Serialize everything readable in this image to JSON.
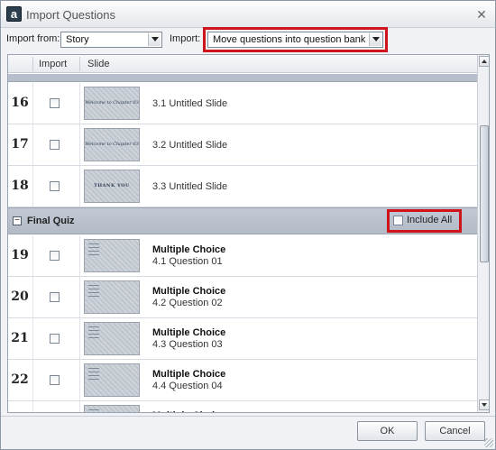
{
  "window": {
    "title": "Import Questions",
    "app_icon_glyph": "a",
    "close_glyph": "✕"
  },
  "toolbar": {
    "import_from_label": "Import from:",
    "import_from_value": "Story",
    "import_label": "Import:",
    "import_value": "Move questions into question bank"
  },
  "grid": {
    "columns": {
      "import": "Import",
      "slide": "Slide"
    },
    "slides": [
      {
        "number": "16",
        "label": "3.1 Untitled Slide",
        "thumb_text": "Welcome to Chapter 03"
      },
      {
        "number": "17",
        "label": "3.2 Untitled Slide",
        "thumb_text": "Welcome to Chapter 03"
      },
      {
        "number": "18",
        "label": "3.3 Untitled Slide",
        "thumb_text": "THANK YOU"
      }
    ],
    "group": {
      "toggle_glyph": "−",
      "title": "Final Quiz",
      "include_all_label": "Include All"
    },
    "questions": [
      {
        "number": "19",
        "type": "Multiple Choice",
        "label": "4.1 Question 01"
      },
      {
        "number": "20",
        "type": "Multiple Choice",
        "label": "4.2 Question 02"
      },
      {
        "number": "21",
        "type": "Multiple Choice",
        "label": "4.3 Question 03"
      },
      {
        "number": "22",
        "type": "Multiple Choice",
        "label": "4.4 Question 04"
      },
      {
        "number": "",
        "type": "Multiple Choice",
        "label": ""
      }
    ]
  },
  "buttons": {
    "ok": "OK",
    "cancel": "Cancel"
  },
  "colors": {
    "highlight": "#d0141b",
    "group_bar": "#b7bfcc"
  }
}
